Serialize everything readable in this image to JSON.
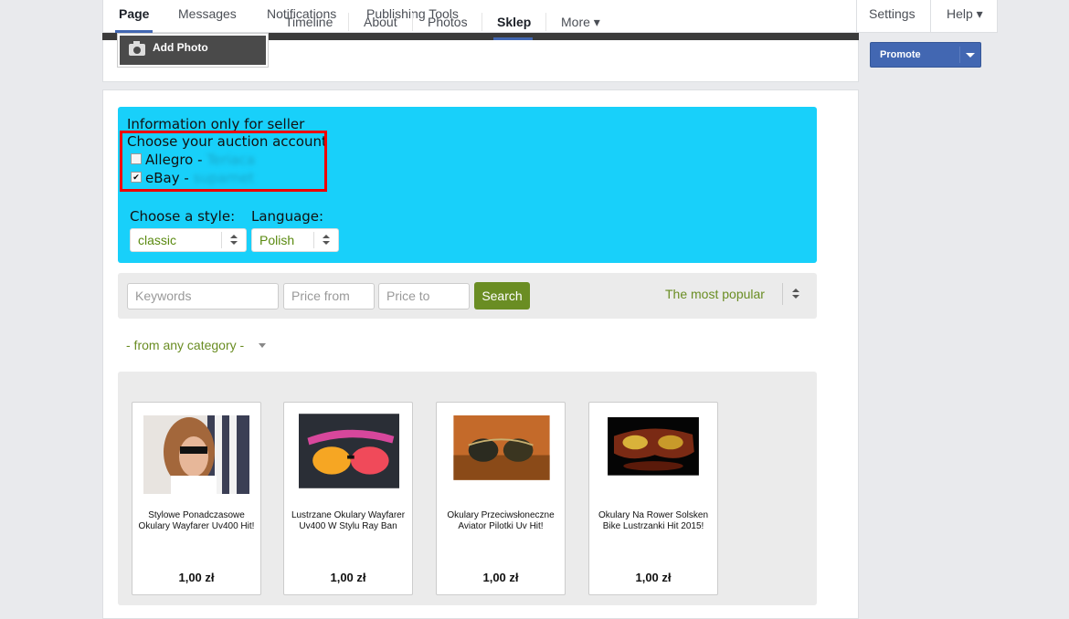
{
  "top_nav": {
    "page": "Page",
    "messages": "Messages",
    "notifications": "Notifications",
    "publishing_tools": "Publishing Tools",
    "settings": "Settings",
    "help": "Help ▾"
  },
  "cover": {
    "add_photo": "Add Photo"
  },
  "sub_nav": {
    "timeline": "Timeline",
    "about": "About",
    "photos": "Photos",
    "sklep": "Sklep",
    "more": "More ▾"
  },
  "promote": "Promote",
  "seller_info": {
    "title": "Information only for seller",
    "choose_account": "Choose your auction account",
    "accounts": [
      {
        "name": "Allegro - ",
        "user": "Teriaca",
        "checked": false
      },
      {
        "name": "eBay - ",
        "user": "suparnet",
        "checked": true
      }
    ],
    "style_label": "Choose a style:",
    "style_value": "classic",
    "language_label": "Language:",
    "language_value": "Polish"
  },
  "search": {
    "keywords_placeholder": "Keywords",
    "price_from_placeholder": "Price from",
    "price_to_placeholder": "Price to",
    "search_button": "Search",
    "sort_value": "The most popular"
  },
  "category": "- from any category -",
  "products": [
    {
      "name": "Stylowe Ponadczasowe Okulary Wayfarer Uv400 Hit!",
      "price": "1,00 zł"
    },
    {
      "name": "Lustrzane Okulary Wayfarer Uv400 W Stylu Ray Ban",
      "price": "1,00 zł"
    },
    {
      "name": "Okulary Przeciwsłoneczne Aviator Pilotki Uv Hit!",
      "price": "1,00 zł"
    },
    {
      "name": "Okulary Na Rower Solsken Bike Lustrzanki Hit 2015!",
      "price": "1,00 zł"
    }
  ],
  "colors": {
    "accent": "#4267b2",
    "info_bg": "#18d0fa",
    "green": "#6a8d23",
    "highlight": "#ee0000"
  }
}
